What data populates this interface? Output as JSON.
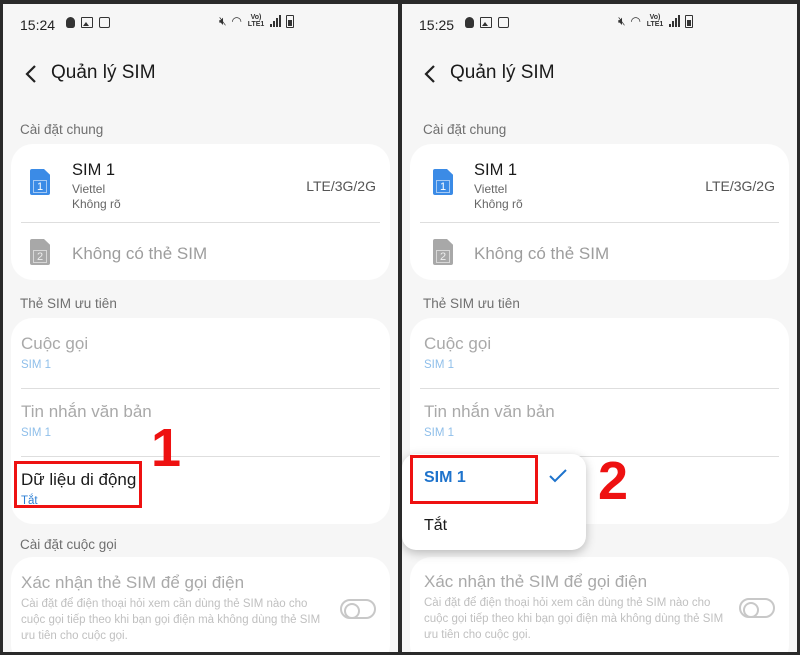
{
  "left": {
    "status": {
      "time": "15:24",
      "network": "Vo) LTE1"
    },
    "title": "Quản lý SIM",
    "general_label": "Cài đặt chung",
    "sim1": {
      "name": "SIM 1",
      "carrier": "Viettel",
      "status": "Không rõ",
      "tech": "LTE/3G/2G",
      "number": "1"
    },
    "sim2": {
      "name": "Không có thẻ SIM",
      "number": "2"
    },
    "preferred_label": "Thẻ SIM ưu tiên",
    "calls": {
      "name": "Cuộc gọi",
      "value": "SIM 1"
    },
    "messages": {
      "name": "Tin nhắn văn bản",
      "value": "SIM 1"
    },
    "mobile_data": {
      "name": "Dữ liệu di động",
      "value": "Tắt"
    },
    "call_settings_label": "Cài đặt cuộc gọi",
    "confirm": {
      "title": "Xác nhận thẻ SIM để gọi điện",
      "desc": "Cài đặt để điện thoại hỏi xem cần dùng thẻ SIM nào cho cuộc gọi tiếp theo khi bạn gọi điện mà không dùng thẻ SIM ưu tiên cho cuộc gọi."
    },
    "annotation": "1"
  },
  "right": {
    "status": {
      "time": "15:25",
      "network": "Vo) LTE1"
    },
    "title": "Quản lý SIM",
    "general_label": "Cài đặt chung",
    "sim1": {
      "name": "SIM 1",
      "carrier": "Viettel",
      "status": "Không rõ",
      "tech": "LTE/3G/2G",
      "number": "1"
    },
    "sim2": {
      "name": "Không có thẻ SIM",
      "number": "2"
    },
    "preferred_label": "Thẻ SIM ưu tiên",
    "calls": {
      "name": "Cuộc gọi",
      "value": "SIM 1"
    },
    "messages": {
      "name": "Tin nhắn văn bản",
      "value": "SIM 1"
    },
    "popup": {
      "option_sim1": "SIM 1",
      "option_off": "Tắt"
    },
    "confirm": {
      "title": "Xác nhận thẻ SIM để gọi điện",
      "desc": "Cài đặt để điện thoại hỏi xem cần dùng thẻ SIM nào cho cuộc gọi tiếp theo khi bạn gọi điện mà không dùng thẻ SIM ưu tiên cho cuộc gọi."
    },
    "annotation": "2"
  },
  "colors": {
    "accent": "#1e73cc",
    "annotation": "#ee1111",
    "sim_blue": "#3b8be6"
  }
}
